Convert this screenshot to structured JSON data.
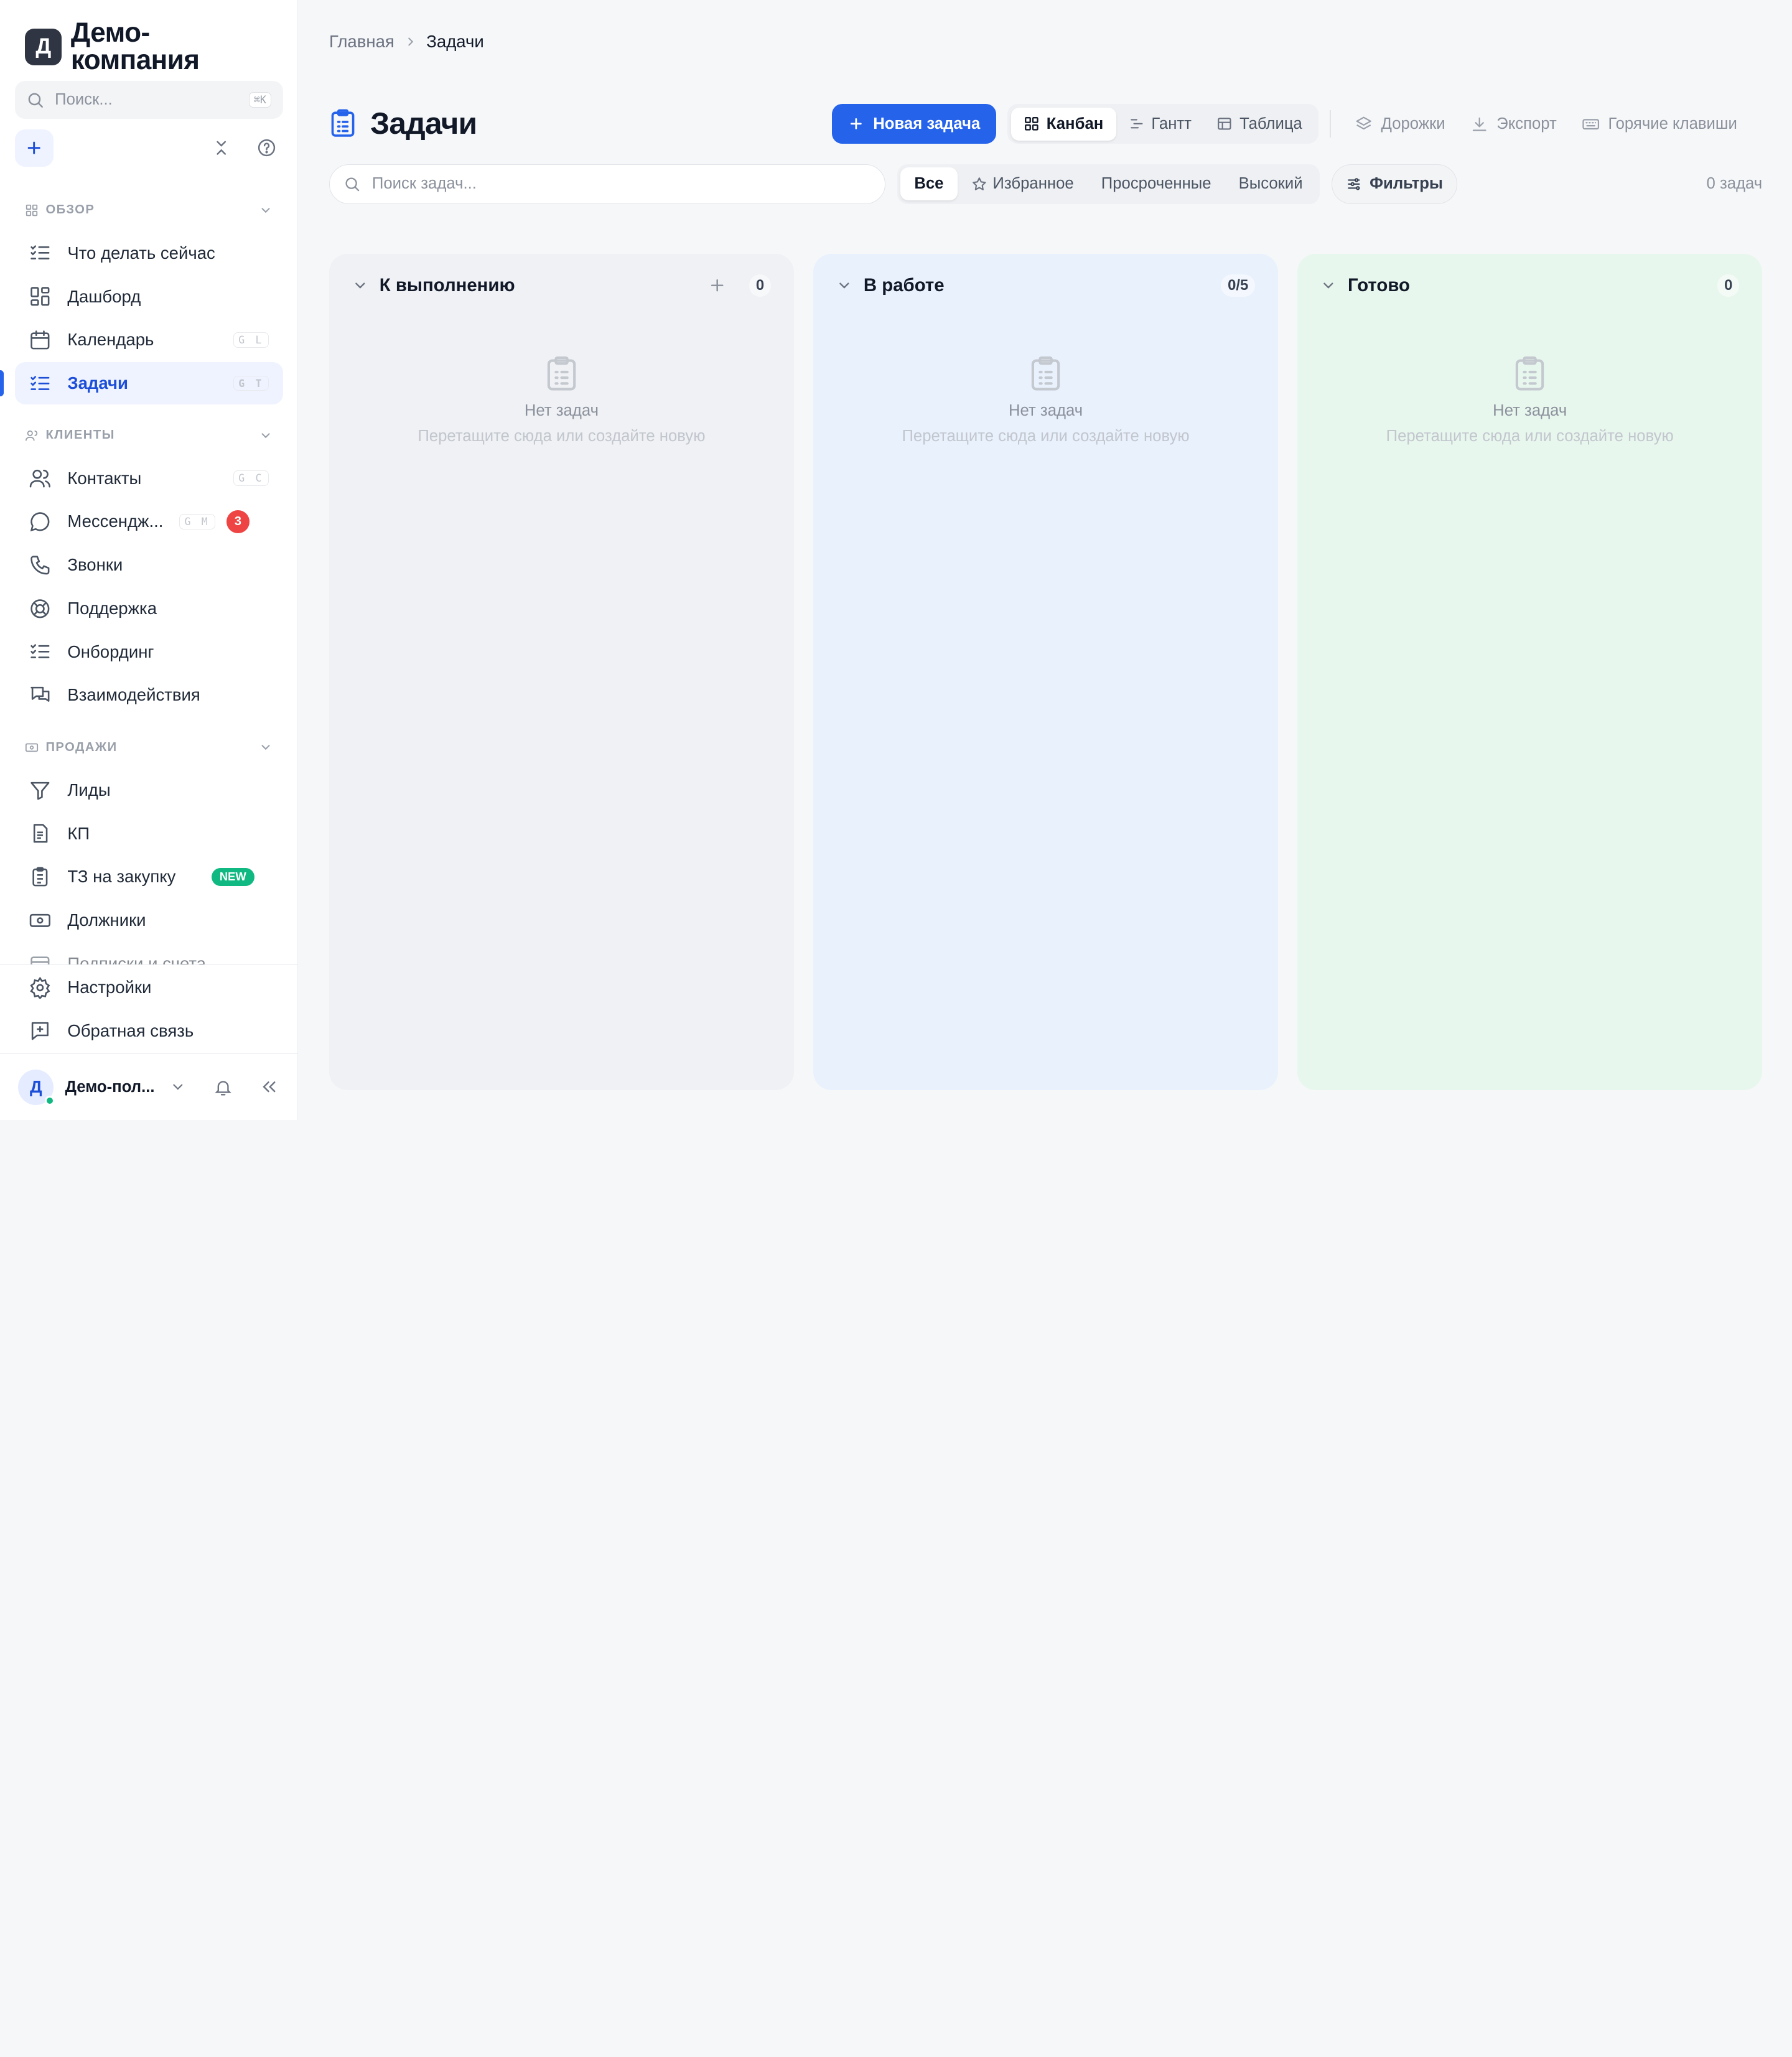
{
  "brand": {
    "logo_letter": "Д",
    "name_line1": "Демо-",
    "name_line2": "компания"
  },
  "sidebar": {
    "search": {
      "placeholder": "Поиск...",
      "shortcut": "⌘K"
    },
    "sections": [
      {
        "title": "ОБЗОР",
        "items": [
          {
            "label": "Что делать сейчас",
            "icon": "list-check-icon"
          },
          {
            "label": "Дашборд",
            "icon": "grid-icon"
          },
          {
            "label": "Календарь",
            "icon": "calendar-icon",
            "shortcut": "G L"
          },
          {
            "label": "Задачи",
            "icon": "list-check-icon",
            "shortcut": "G T",
            "active": true
          }
        ]
      },
      {
        "title": "КЛИЕНТЫ",
        "items": [
          {
            "label": "Контакты",
            "icon": "users-icon",
            "shortcut": "G C"
          },
          {
            "label": "Мессендж...",
            "icon": "chat-icon",
            "shortcut": "G M",
            "badge": "3"
          },
          {
            "label": "Звонки",
            "icon": "phone-icon"
          },
          {
            "label": "Поддержка",
            "icon": "lifebuoy-icon"
          },
          {
            "label": "Онбординг",
            "icon": "list-check-icon"
          },
          {
            "label": "Взаимодействия",
            "icon": "messages-icon"
          }
        ]
      },
      {
        "title": "ПРОДАЖИ",
        "items": [
          {
            "label": "Лиды",
            "icon": "funnel-icon"
          },
          {
            "label": "КП",
            "icon": "document-icon"
          },
          {
            "label": "ТЗ на закупку",
            "icon": "clipboard-icon",
            "new_badge": "NEW"
          },
          {
            "label": "Должники",
            "icon": "banknote-icon"
          },
          {
            "label": "Подписки и счета",
            "icon": "receipt-icon"
          }
        ]
      }
    ],
    "bottom": [
      {
        "label": "Настройки",
        "icon": "gear-icon"
      },
      {
        "label": "Обратная связь",
        "icon": "feedback-icon"
      }
    ],
    "user": {
      "avatar_letter": "Д",
      "name": "Демо-пол..."
    }
  },
  "breadcrumb": {
    "home": "Главная",
    "current": "Задачи"
  },
  "page": {
    "title": "Задачи"
  },
  "toolbar": {
    "new_task": "Новая задача",
    "views": [
      "Канбан",
      "Гантт",
      "Таблица"
    ],
    "active_view": "Канбан",
    "lanes": "Дорожки",
    "export": "Экспорт",
    "hotkeys": "Горячие клавиши"
  },
  "filters": {
    "search_placeholder": "Поиск задач...",
    "chips": [
      "Все",
      "Избранное",
      "Просроченные",
      "Высокий"
    ],
    "active_chip": "Все",
    "filters_button": "Фильтры",
    "count": "0 задач"
  },
  "board": {
    "columns": [
      {
        "name": "К выполнению",
        "count": "0",
        "empty_title": "Нет задач",
        "empty_hint": "Перетащите сюда или создайте новую"
      },
      {
        "name": "В работе",
        "count": "0/5",
        "empty_title": "Нет задач",
        "empty_hint": "Перетащите сюда или создайте новую"
      },
      {
        "name": "Готово",
        "count": "0",
        "empty_title": "Нет задач",
        "empty_hint": "Перетащите сюда или создайте новую"
      }
    ]
  },
  "colors": {
    "accent": "#2563eb",
    "badge_red": "#ef4444",
    "badge_new": "#10b981"
  }
}
